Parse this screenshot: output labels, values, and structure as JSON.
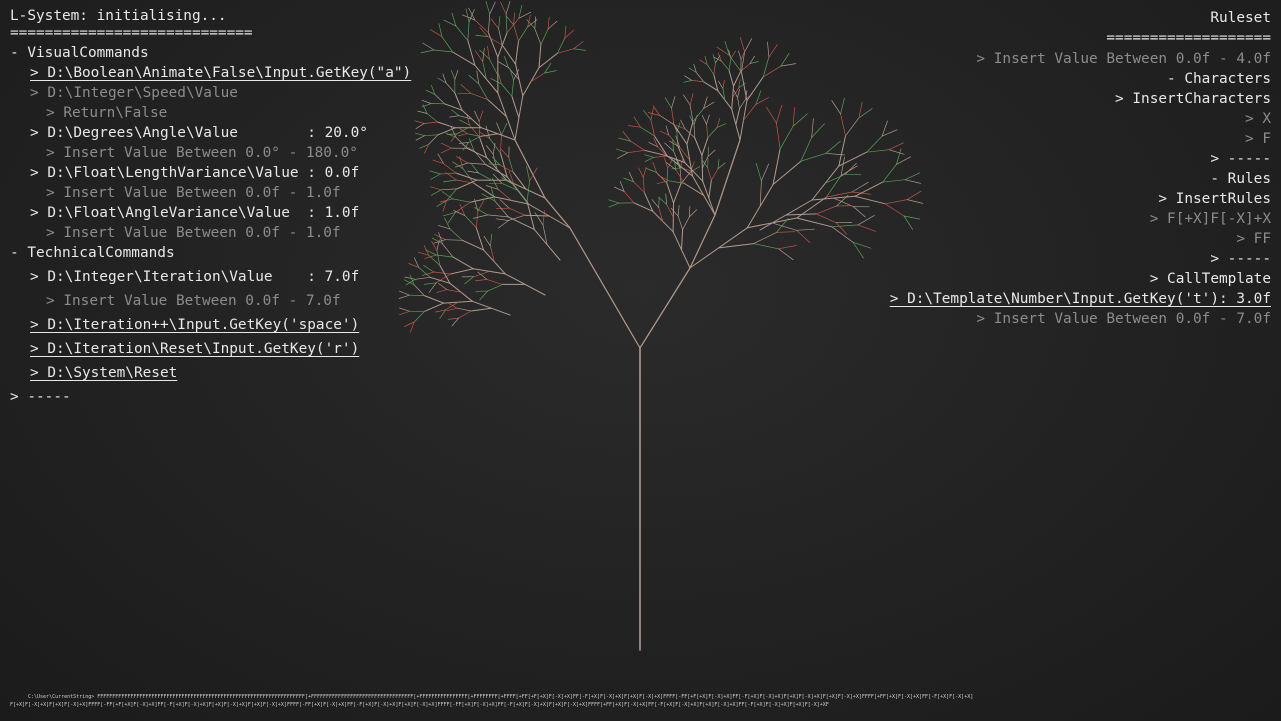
{
  "title": "L-System: initialising...",
  "title_rule": "============================",
  "left_menu": [
    {
      "text": "- VisualCommands",
      "indent": 0,
      "dim": false,
      "underline": false,
      "interactable": false,
      "name": "section-visual-commands"
    },
    {
      "text": "> D:\\Boolean\\Animate\\False\\Input.GetKey(\"a\")",
      "indent": 1,
      "dim": false,
      "underline": true,
      "interactable": true,
      "name": "cmd-animate-toggle"
    },
    {
      "text": "> D:\\Integer\\Speed\\Value",
      "indent": 2,
      "dim": true,
      "underline": false,
      "interactable": true,
      "name": "cmd-speed-value"
    },
    {
      "text": "> Return\\False",
      "indent": 3,
      "dim": true,
      "underline": false,
      "interactable": false,
      "name": "speed-return-false"
    },
    {
      "text": "> D:\\Degrees\\Angle\\Value        : 20.0°",
      "indent": 2,
      "dim": false,
      "underline": false,
      "interactable": true,
      "name": "cmd-angle-value"
    },
    {
      "text": "> Insert Value Between 0.0° - 180.0°",
      "indent": 3,
      "dim": true,
      "underline": false,
      "interactable": false,
      "name": "angle-range-hint"
    },
    {
      "text": "> D:\\Float\\LengthVariance\\Value : 0.0f",
      "indent": 2,
      "dim": false,
      "underline": false,
      "interactable": true,
      "name": "cmd-length-variance"
    },
    {
      "text": "> Insert Value Between 0.0f - 1.0f",
      "indent": 3,
      "dim": true,
      "underline": false,
      "interactable": false,
      "name": "length-variance-hint"
    },
    {
      "text": "> D:\\Float\\AngleVariance\\Value  : 1.0f",
      "indent": 2,
      "dim": false,
      "underline": false,
      "interactable": true,
      "name": "cmd-angle-variance"
    },
    {
      "text": "> Insert Value Between 0.0f - 1.0f",
      "indent": 3,
      "dim": true,
      "underline": false,
      "interactable": false,
      "name": "angle-variance-hint"
    },
    {
      "text": "- TechnicalCommands",
      "indent": 0,
      "dim": false,
      "underline": false,
      "interactable": false,
      "name": "section-technical-commands"
    },
    {
      "text": "> D:\\Integer\\Iteration\\Value    : 7.0f",
      "indent": 2,
      "dim": false,
      "underline": false,
      "interactable": true,
      "name": "cmd-iteration-value"
    },
    {
      "text": "> Insert Value Between 0.0f - 7.0f",
      "indent": 3,
      "dim": true,
      "underline": false,
      "interactable": false,
      "name": "iteration-range-hint"
    },
    {
      "text": "> D:\\Iteration++\\Input.GetKey('space')",
      "indent": 2,
      "dim": false,
      "underline": true,
      "interactable": true,
      "name": "cmd-iteration-increment"
    },
    {
      "text": "> D:\\Iteration\\Reset\\Input.GetKey('r')",
      "indent": 2,
      "dim": false,
      "underline": true,
      "interactable": true,
      "name": "cmd-iteration-reset"
    },
    {
      "text": "> D:\\System\\Reset",
      "indent": 2,
      "dim": false,
      "underline": true,
      "interactable": true,
      "name": "cmd-system-reset"
    },
    {
      "text": "> -----",
      "indent": 0,
      "dim": false,
      "underline": false,
      "interactable": false,
      "name": "left-menu-end"
    }
  ],
  "right_menu": [
    {
      "text": "Ruleset",
      "dim": false,
      "underline": false,
      "interactable": false,
      "name": "ruleset-title"
    },
    {
      "text": "===================",
      "dim": false,
      "underline": false,
      "interactable": false,
      "name": "ruleset-rule"
    },
    {
      "text": "> Insert Value Between 0.0f - 4.0f",
      "dim": true,
      "underline": false,
      "interactable": false,
      "name": "ruleset-range-hint"
    },
    {
      "text": "- Characters",
      "dim": false,
      "underline": false,
      "interactable": false,
      "name": "section-characters"
    },
    {
      "text": "> InsertCharacters",
      "dim": false,
      "underline": false,
      "interactable": true,
      "name": "cmd-insert-characters"
    },
    {
      "text": "> X",
      "dim": true,
      "underline": false,
      "interactable": false,
      "name": "character-x"
    },
    {
      "text": "> F",
      "dim": true,
      "underline": false,
      "interactable": false,
      "name": "character-f"
    },
    {
      "text": "> -----",
      "dim": false,
      "underline": false,
      "interactable": false,
      "name": "characters-end"
    },
    {
      "text": "- Rules",
      "dim": false,
      "underline": false,
      "interactable": false,
      "name": "section-rules"
    },
    {
      "text": "> InsertRules",
      "dim": false,
      "underline": false,
      "interactable": true,
      "name": "cmd-insert-rules"
    },
    {
      "text": "> F[+X]F[-X]+X",
      "dim": true,
      "underline": false,
      "interactable": false,
      "name": "rule-x"
    },
    {
      "text": "> FF",
      "dim": true,
      "underline": false,
      "interactable": false,
      "name": "rule-f"
    },
    {
      "text": "> -----",
      "dim": false,
      "underline": false,
      "interactable": false,
      "name": "rules-end"
    },
    {
      "text": "> CallTemplate",
      "dim": false,
      "underline": false,
      "interactable": true,
      "name": "cmd-call-template"
    },
    {
      "text": "> D:\\Template\\Number\\Input.GetKey('t'): 3.0f",
      "dim": false,
      "underline": true,
      "interactable": true,
      "name": "cmd-template-number"
    },
    {
      "text": "> Insert Value Between 0.0f - 7.0f",
      "dim": true,
      "underline": false,
      "interactable": false,
      "name": "template-range-hint"
    }
  ],
  "current_string": {
    "line1": "C:\\User\\CurrentString> FFFFFFFFFFFFFFFFFFFFFFFFFFFFFFFFFFFFFFFFFFFFFFFFFFFFFFFFFFFFFFFFFFFFF[+FFFFFFFFFFFFFFFFFFFFFFFFFFFFFFFFFF[+FFFFFFFFFFFFFFFF[+FFFFFFFF[+FFFF[+FF[+F[+X]F[-X]+X]FF[-F[+X]F[-X]+X]F[+X]F[-X]+X]FFFF[-FF[+F[+X]F[-X]+X]FF[-F[+X]F[-X]+X]F[+X]F[-X]+X]F[+X]F[-X]+X]FFFF[+FF[+X]F[-X]+X]FF[-F[+X]F[-X]+X]",
    "line2": "F[+X]F[-X]+X]F[+X]F[-X]+X]FFFF[-FF[+F[+X]F[-X]+X]FF[-F[+X]F[-X]+X]F[+X]F[-X]+X]F[+X]F[-X]+X]FFFF[-FF[+X]F[-X]+X]FF[-F[+X]F[-X]+X]F[+X]F[-X]+X]FFFF[-FF[+X]F[-X]+X]FF[-F[+X]F[-X]+X]F[+X]F[-X]+X]FFFF[+FF[+X]F[-X]+X]FF[-F[+X]F[-X]+X]F[+X]F[-X]+X]FF[-F[+X]F[-X]+X]F[+X]F[-X]+XF"
  },
  "colors": {
    "background": "#222222",
    "text": "#e8e8e8",
    "text_dim": "#8c8c8c",
    "trunk": "#b09a8e",
    "leaf_red": "#c0564a",
    "leaf_green": "#5aa05a"
  },
  "render": {
    "axiom": "X",
    "rule_x": "F[+X]F[-X]+X",
    "rule_f": "FF",
    "angle_deg": 20.0,
    "iterations": 7
  }
}
